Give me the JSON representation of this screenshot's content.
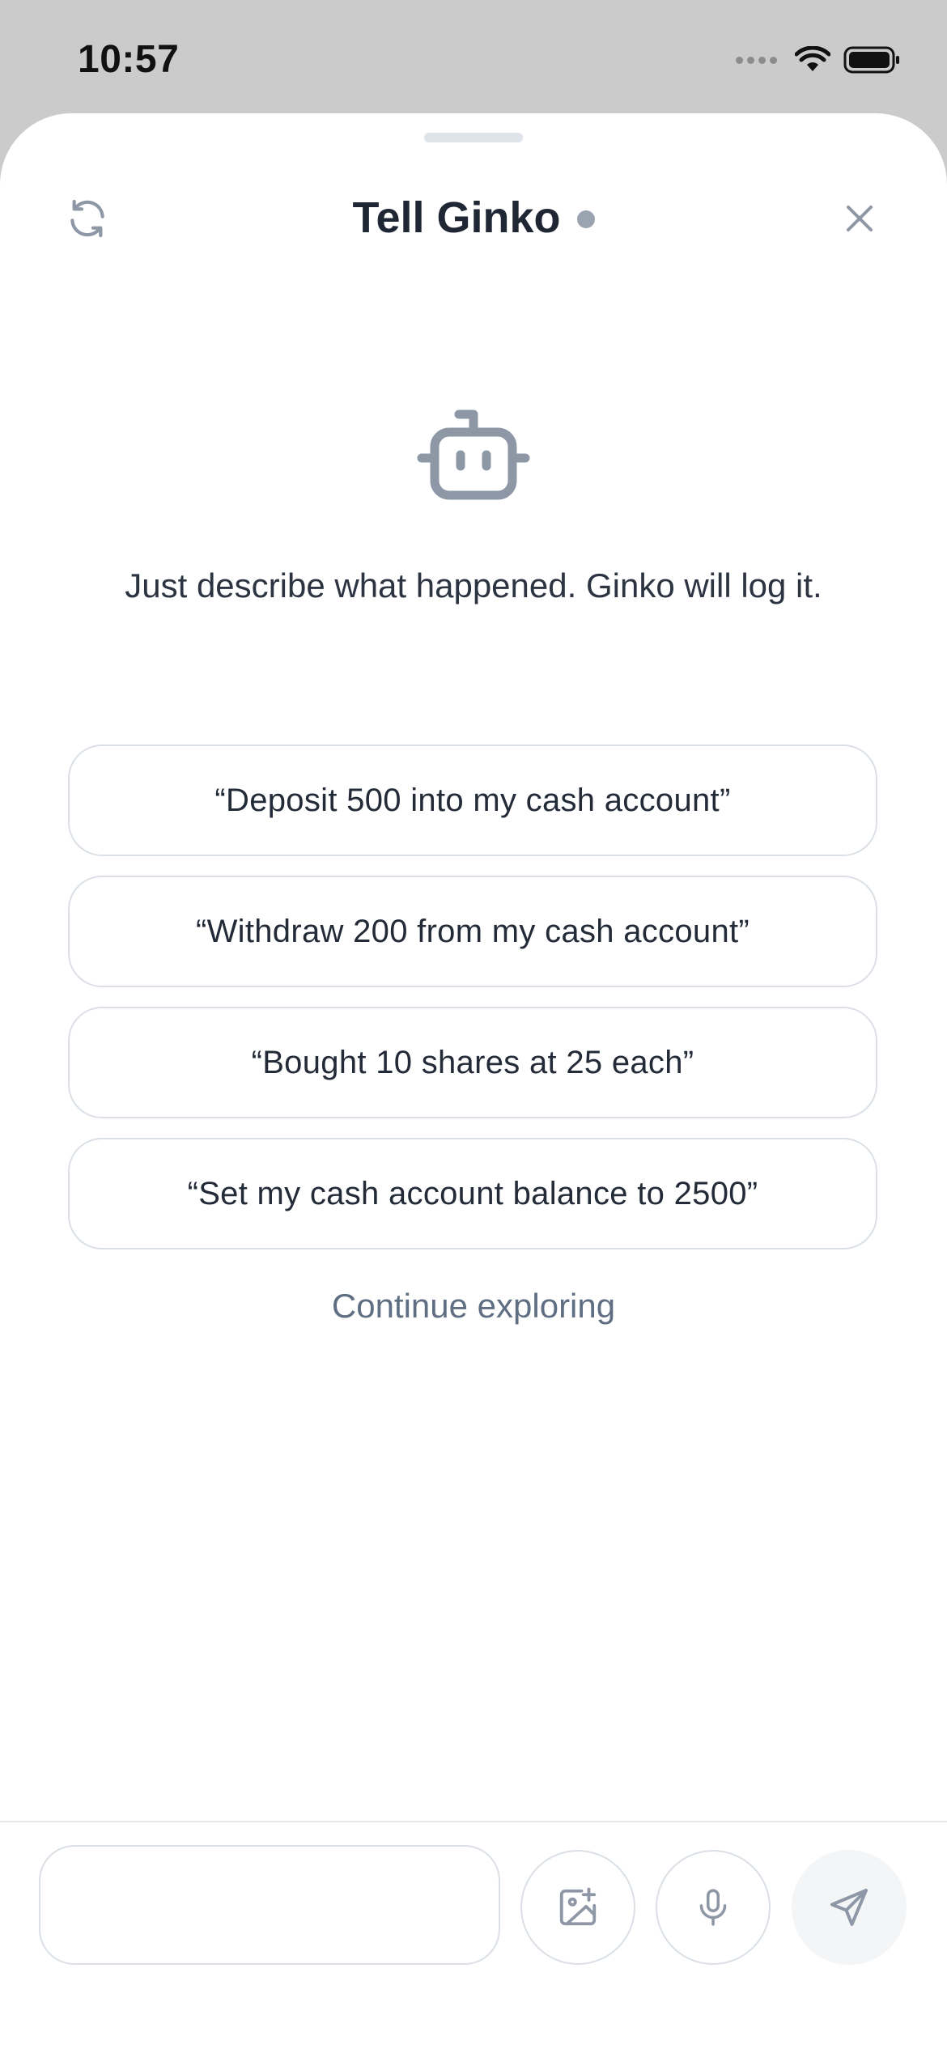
{
  "status_bar": {
    "time": "10:57"
  },
  "header": {
    "title": "Tell Ginko",
    "icons": {
      "left": "refresh-icon",
      "right": "close-icon"
    }
  },
  "main": {
    "icon": "robot-icon",
    "intro_text": "Just describe what happened. Ginko will log it.",
    "suggestions": [
      "“Deposit 500 into my cash account”",
      "“Withdraw 200 from my cash account”",
      "“Bought 10 shares at 25 each”",
      "“Set my cash account balance to 2500”"
    ],
    "continue_label": "Continue exploring"
  },
  "composer": {
    "input_value": "",
    "buttons": [
      "image-add-icon",
      "microphone-icon",
      "send-icon"
    ]
  },
  "colors": {
    "backdrop": "#cbcbcb",
    "sheet": "#ffffff",
    "title_text": "#1f2735",
    "muted_icon": "#8e97a6",
    "border": "#dbe0e7",
    "link": "#5f6e82"
  }
}
